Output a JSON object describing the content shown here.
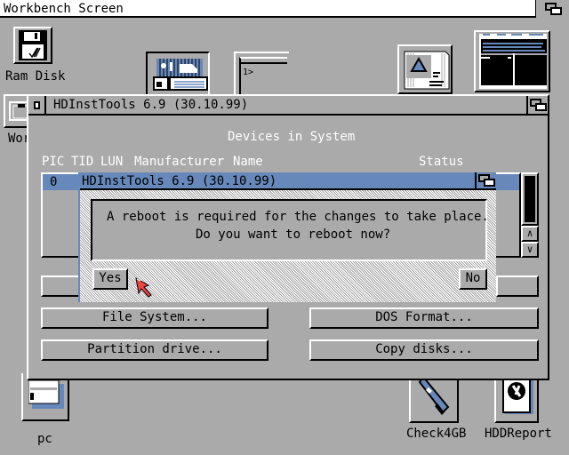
{
  "screen": {
    "title": "Workbench Screen"
  },
  "desktop_icons": [
    {
      "label": "Ram Disk",
      "icon": "ram-disk-icon"
    },
    {
      "label": "Wor",
      "icon": "workbench-drawer-icon"
    },
    {
      "label": "",
      "icon": "prefs-tool-icon"
    },
    {
      "label": "",
      "icon": "shell-window-icon"
    },
    {
      "label": "",
      "icon": "picture-icon"
    },
    {
      "label": "",
      "icon": "screen-thumbnail-icon"
    },
    {
      "label": "pc",
      "icon": "pc-drawer-icon"
    },
    {
      "label": "Check4GB",
      "icon": "check4gb-tool-icon"
    },
    {
      "label": "HDDReport",
      "icon": "hddreport-tool-icon"
    }
  ],
  "main_window": {
    "title": "HDInstTools 6.9 (30.10.99)",
    "heading": "Devices in System",
    "columns": [
      "PIC",
      "TID",
      "LUN",
      "Manufacturer",
      "Name",
      "Status"
    ],
    "rows": [
      {
        "pic": "",
        "tid": "0",
        "lun": "",
        "manufacturer": "",
        "name": "",
        "status": ""
      }
    ],
    "buttons": {
      "file_system": {
        "label": "File System...",
        "hotkey": "F"
      },
      "dos_format": {
        "label": "DOS Format...",
        "hotkey": "D"
      },
      "partition_drive": {
        "label": "Partition drive...",
        "hotkey": "P"
      },
      "copy_disks": {
        "label": "Copy disks...",
        "hotkey": ""
      }
    }
  },
  "requester": {
    "title": "HDInstTools 6.9 (30.10.99)",
    "message_line1": "A reboot is required for the changes to take place.",
    "message_line2": "Do you want to reboot now?",
    "yes_label": "Yes",
    "no_label": "No"
  },
  "colors": {
    "background": "#aaaaaa",
    "accent": "#6688bb",
    "pointer": "#ee4444"
  }
}
